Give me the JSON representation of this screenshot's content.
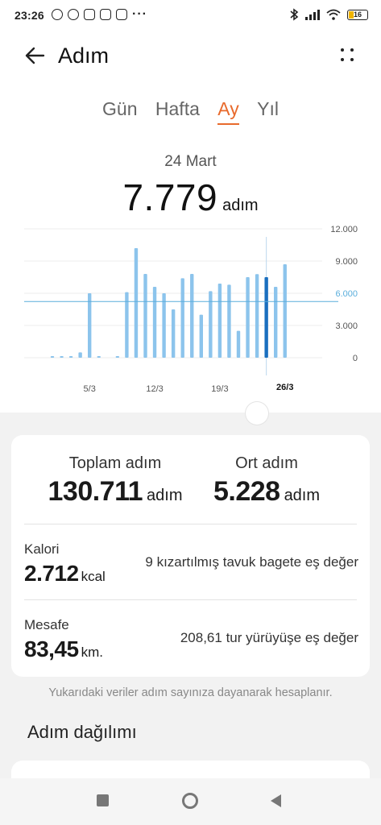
{
  "status_bar": {
    "time": "23:26",
    "battery": "16",
    "more": "···"
  },
  "header": {
    "title": "Adım"
  },
  "tabs": [
    {
      "label": "Gün"
    },
    {
      "label": "Hafta"
    },
    {
      "label": "Ay",
      "active": true
    },
    {
      "label": "Yıl"
    }
  ],
  "selected": {
    "date": "24 Mart",
    "value": "7.779",
    "unit": "adım"
  },
  "chart_data": {
    "type": "bar",
    "y_ticks": [
      "12.000",
      "9.000",
      "6.000",
      "3.000",
      "0"
    ],
    "ylim": [
      0,
      12000
    ],
    "reference_line": {
      "value": 5228,
      "label": "6.000",
      "color": "#5aaedc"
    },
    "x_tick_labels": [
      {
        "label": "5/3",
        "day": 5
      },
      {
        "label": "12/3",
        "day": 12
      },
      {
        "label": "19/3",
        "day": 19
      },
      {
        "label": "26/3",
        "day": 26,
        "bold": true
      }
    ],
    "days": [
      1,
      2,
      3,
      4,
      5,
      6,
      7,
      8,
      9,
      10,
      11,
      12,
      13,
      14,
      15,
      16,
      17,
      18,
      19,
      20,
      21,
      22,
      23,
      24,
      25,
      26,
      27
    ],
    "values": [
      100,
      100,
      100,
      500,
      6000,
      100,
      0,
      100,
      6100,
      10200,
      7800,
      6600,
      6000,
      4500,
      7400,
      7800,
      4000,
      6200,
      6900,
      6800,
      2500,
      7500,
      7779,
      7500,
      6600,
      8700,
      0
    ],
    "highlight_day": 24,
    "bar_color": "#8cc4ec",
    "highlight_color": "#1a6fbf",
    "grid": true
  },
  "summary": {
    "total_label": "Toplam adım",
    "total_value": "130.711",
    "total_unit": "adım",
    "avg_label": "Ort adım",
    "avg_value": "5.228",
    "avg_unit": "adım"
  },
  "calorie": {
    "label": "Kalori",
    "value": "2.712",
    "unit": "kcal",
    "equiv": "9 kızartılmış tavuk bagete eş değer"
  },
  "distance": {
    "label": "Mesafe",
    "value": "83,45",
    "unit": "km.",
    "equiv": "208,61 tur yürüyüşe eş değer"
  },
  "note": "Yukarıdaki veriler adım sayınıza dayanarak hesaplanır.",
  "section_title": "Adım dağılımı",
  "icons": {
    "back": "arrow-left-icon",
    "more": "four-dot-menu-icon"
  }
}
